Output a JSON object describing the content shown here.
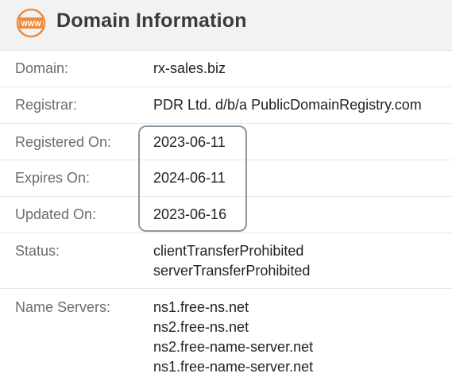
{
  "header": {
    "title": "Domain Information",
    "icon_text": "WWW",
    "icon_color": "#f08a3c"
  },
  "rows": {
    "domain": {
      "label": "Domain:",
      "value": "rx-sales.biz"
    },
    "registrar": {
      "label": "Registrar:",
      "value": "PDR Ltd. d/b/a PublicDomainRegistry.com"
    },
    "registered": {
      "label": "Registered On:",
      "value": "2023-06-11"
    },
    "expires": {
      "label": "Expires On:",
      "value": "2024-06-11"
    },
    "updated": {
      "label": "Updated On:",
      "value": "2023-06-16"
    },
    "status": {
      "label": "Status:",
      "values": [
        "clientTransferProhibited",
        "serverTransferProhibited"
      ]
    },
    "nameservers": {
      "label": "Name Servers:",
      "values": [
        "ns1.free-ns.net",
        "ns2.free-ns.net",
        "ns2.free-name-server.net",
        "ns1.free-name-server.net"
      ]
    }
  },
  "colors": {
    "header_bg": "#f2f2f2",
    "highlight_border": "#8a97a5"
  }
}
